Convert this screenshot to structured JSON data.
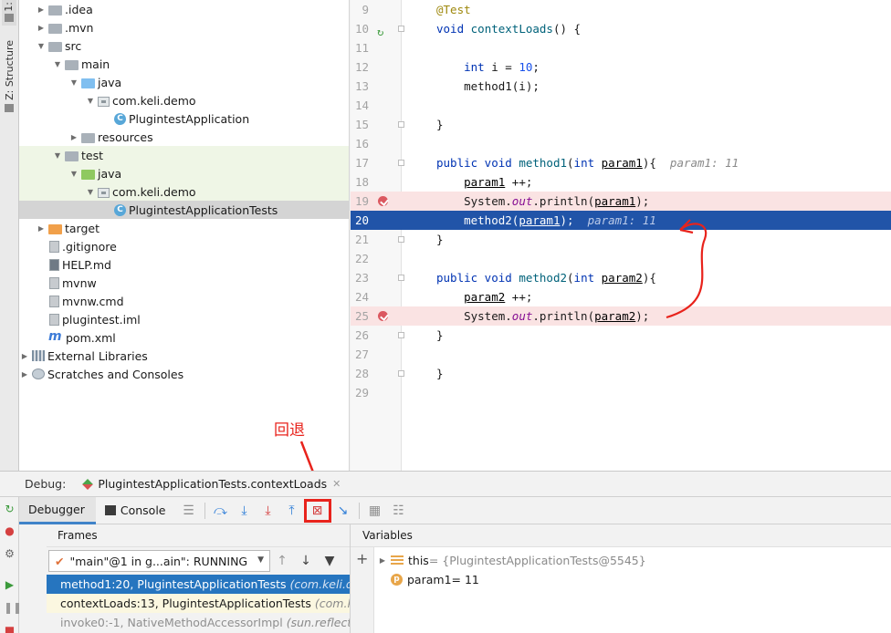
{
  "side_strip": {
    "tab1": "1:",
    "structure_tab": "Z: Structure"
  },
  "tree": [
    {
      "label": ".idea",
      "arrow": "▶",
      "indent": 0,
      "icon": "folder"
    },
    {
      "label": ".mvn",
      "arrow": "▶",
      "indent": 0,
      "icon": "folder"
    },
    {
      "label": "src",
      "arrow": "▼",
      "indent": 0,
      "icon": "folder"
    },
    {
      "label": "main",
      "arrow": "▼",
      "indent": 1,
      "icon": "folder"
    },
    {
      "label": "java",
      "arrow": "▼",
      "indent": 2,
      "icon": "folder-blue"
    },
    {
      "label": "com.keli.demo",
      "arrow": "▼",
      "indent": 3,
      "icon": "package"
    },
    {
      "label": "PlugintestApplication",
      "arrow": "",
      "indent": 4,
      "icon": "class"
    },
    {
      "label": "resources",
      "arrow": "▶",
      "indent": 2,
      "icon": "folder"
    },
    {
      "label": "test",
      "arrow": "▼",
      "indent": 1,
      "icon": "folder"
    },
    {
      "label": "java",
      "arrow": "▼",
      "indent": 2,
      "icon": "folder-green"
    },
    {
      "label": "com.keli.demo",
      "arrow": "▼",
      "indent": 3,
      "icon": "package"
    },
    {
      "label": "PlugintestApplicationTests",
      "arrow": "",
      "indent": 4,
      "icon": "class"
    },
    {
      "label": "target",
      "arrow": "▶",
      "indent": 0,
      "icon": "folder-orange"
    },
    {
      "label": ".gitignore",
      "arrow": "",
      "indent": 0,
      "icon": "file"
    },
    {
      "label": "HELP.md",
      "arrow": "",
      "indent": 0,
      "icon": "file-md"
    },
    {
      "label": "mvnw",
      "arrow": "",
      "indent": 0,
      "icon": "file"
    },
    {
      "label": "mvnw.cmd",
      "arrow": "",
      "indent": 0,
      "icon": "file"
    },
    {
      "label": "plugintest.iml",
      "arrow": "",
      "indent": 0,
      "icon": "file"
    },
    {
      "label": "pom.xml",
      "arrow": "",
      "indent": 0,
      "icon": "maven"
    },
    {
      "label": "External Libraries",
      "arrow": "▶",
      "indent": -1,
      "icon": "library"
    },
    {
      "label": "Scratches and Consoles",
      "arrow": "▶",
      "indent": -1,
      "icon": "scratch"
    }
  ],
  "code": [
    {
      "n": "9",
      "html": "<span class='ann'>@Test</span>"
    },
    {
      "n": "10",
      "html": "<span class='kw'>void</span> <span class='fn'>contextLoads</span>() {",
      "run": true
    },
    {
      "n": "11",
      "html": ""
    },
    {
      "n": "12",
      "html": "    <span class='kw'>int</span> i = <span class='num'>10</span>;"
    },
    {
      "n": "13",
      "html": "    method1(i);"
    },
    {
      "n": "14",
      "html": ""
    },
    {
      "n": "15",
      "html": "}"
    },
    {
      "n": "16",
      "html": ""
    },
    {
      "n": "17",
      "html": "<span class='kw'>public void</span> <span class='fn'>method1</span>(<span class='kw'>int</span> <span class='prm'>param1</span>){  <span class='hint'>param1: 11</span>"
    },
    {
      "n": "18",
      "html": "    <span class='prm'>param1</span> ++;"
    },
    {
      "n": "19",
      "html": "    System.<span class='out'>out</span>.println(<span class='prm'>param1</span>);",
      "bp": true
    },
    {
      "n": "20",
      "html": "    method2(<span class='prm'>param1</span>);  <span class='hint'>param1: 11</span>",
      "cur": true
    },
    {
      "n": "21",
      "html": "}"
    },
    {
      "n": "22",
      "html": ""
    },
    {
      "n": "23",
      "html": "<span class='kw'>public void</span> <span class='fn'>method2</span>(<span class='kw'>int</span> <span class='prm'>param2</span>){"
    },
    {
      "n": "24",
      "html": "    <span class='prm'>param2</span> ++;"
    },
    {
      "n": "25",
      "html": "    System.<span class='out'>out</span>.println(<span class='prm'>param2</span>);",
      "bp": true
    },
    {
      "n": "26",
      "html": "}"
    },
    {
      "n": "27",
      "html": ""
    },
    {
      "n": "28",
      "html": "}"
    },
    {
      "n": "29",
      "html": ""
    }
  ],
  "annotation": {
    "label": "回退"
  },
  "debug": {
    "title": "Debug:",
    "session_tab": "PlugintestApplicationTests.contextLoads",
    "tabs": {
      "debugger": "Debugger",
      "console": "Console"
    },
    "frames_header": "Frames",
    "variables_header": "Variables",
    "thread": "\"main\"@1 in g...ain\": RUNNING",
    "frames": [
      {
        "method": "method1:20, PlugintestApplicationTests ",
        "pkg": "(com.keli.demo)"
      },
      {
        "method": "contextLoads:13, PlugintestApplicationTests ",
        "pkg": "(com.keli.demo)"
      },
      {
        "method": "invoke0:-1, NativeMethodAccessorImpl ",
        "pkg": "(sun.reflect)"
      }
    ],
    "variables": [
      {
        "name": "this",
        "value": " = {PlugintestApplicationTests@5545}",
        "icon": "list",
        "arrow": "▶"
      },
      {
        "name": "param1",
        "value": " = 11",
        "icon": "p",
        "arrow": ""
      }
    ]
  },
  "colors": {
    "annotation": "#e8231c",
    "current_line": "#2154a8",
    "breakpoint_line": "#fae3e3",
    "selected_frame": "#2675bf"
  }
}
